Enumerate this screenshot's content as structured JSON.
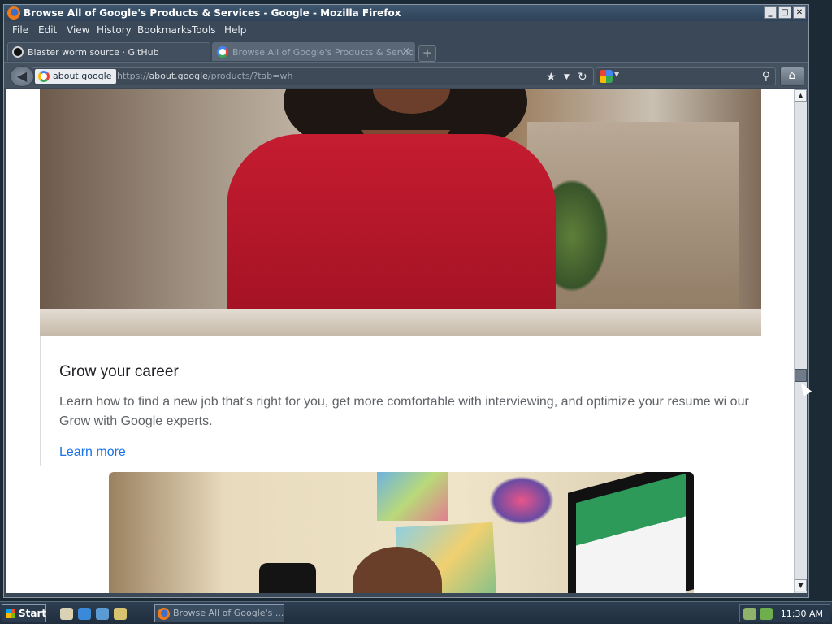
{
  "window": {
    "title": "Browse All of Google's Products & Services - Google - Mozilla Firefox",
    "minimize": "_",
    "maximize": "□",
    "close": "✕"
  },
  "menu": {
    "items": [
      "File",
      "Edit",
      "View",
      "History",
      "Bookmarks",
      "Tools",
      "Help"
    ]
  },
  "tabs": [
    {
      "label": "Blaster worm source · GitHub",
      "icon": "github-icon",
      "active": false
    },
    {
      "label": "Browse All of Google's Products & Service…",
      "icon": "google-icon",
      "active": true,
      "close": "✕"
    }
  ],
  "newtab_symbol": "+",
  "navbar": {
    "back_symbol": "◀",
    "site_identity": "about.google",
    "url_prefix": "https://",
    "url_domain": "about.google",
    "url_path": "/products/?tab=wh",
    "star_symbol": "★",
    "dropdown_symbol": "▼",
    "reload_symbol": "↻",
    "search_placeholder": "",
    "search_drop": "▼",
    "search_symbol": "⚲",
    "home_symbol": "⌂"
  },
  "content": {
    "card_title": "Grow your career",
    "card_description": "Learn how to find a new job that's right for you, get more comfortable with interviewing, and optimize your resume wi our Grow with Google experts.",
    "card_link": "Learn more"
  },
  "scrollbar": {
    "up": "▲",
    "down": "▼"
  },
  "taskbar": {
    "start_label": "Start",
    "task_label": "Browse All of Google's ...",
    "clock": "11:30 AM"
  },
  "colors": {
    "link": "#1a73e8",
    "title_text": "#202124",
    "body_text": "#5f6368"
  }
}
